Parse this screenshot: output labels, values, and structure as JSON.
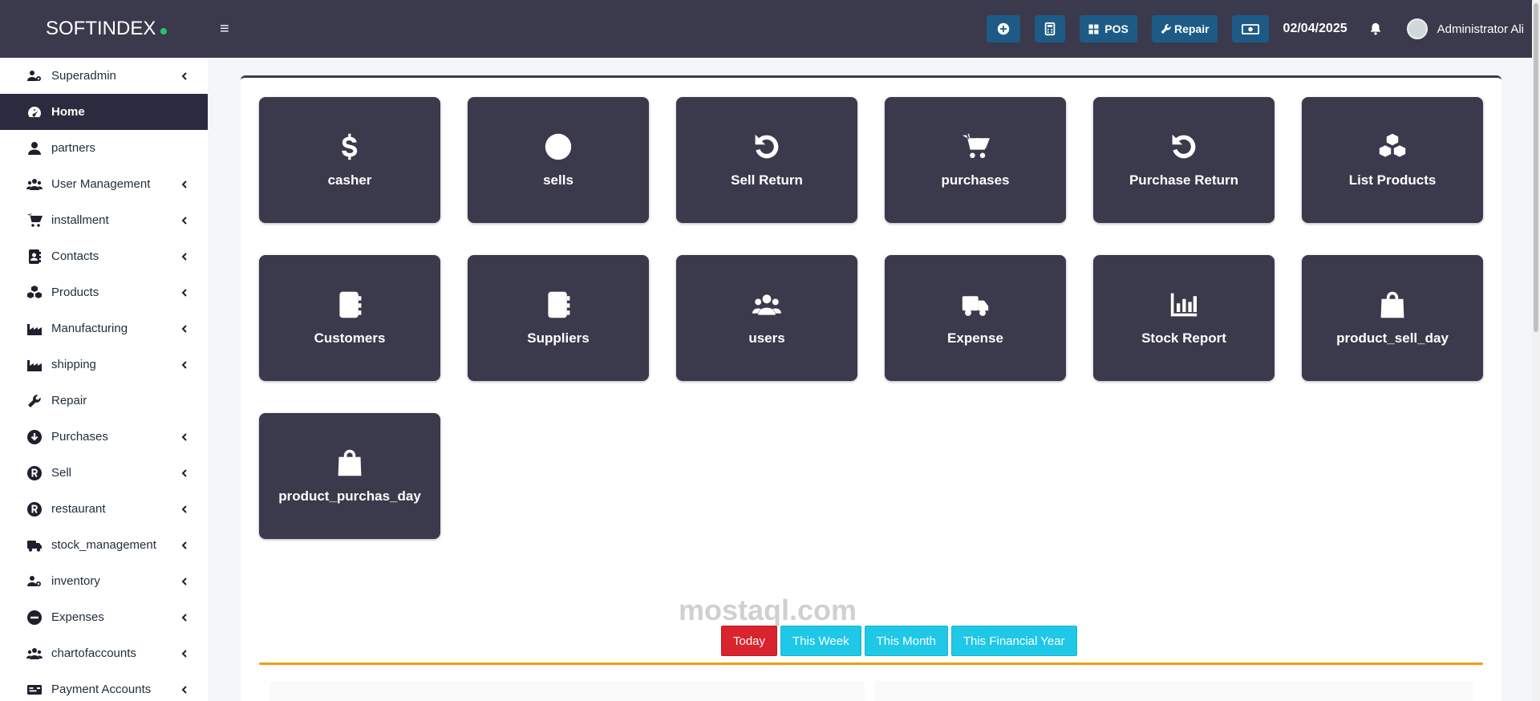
{
  "header": {
    "brand": "SOFTINDEX",
    "menu_icon": "hamburger-icon",
    "actions": [
      {
        "name": "add-button",
        "icon": "plus-circle-icon",
        "label": ""
      },
      {
        "name": "calculator-button",
        "icon": "calculator-icon",
        "label": ""
      },
      {
        "name": "pos-button",
        "icon": "grid-icon",
        "label": "POS"
      },
      {
        "name": "repair-button",
        "icon": "wrench-icon",
        "label": "Repair"
      },
      {
        "name": "cash-button",
        "icon": "money-icon",
        "label": ""
      }
    ],
    "date": "02/04/2025",
    "user": "Administrator Ali"
  },
  "sidebar": {
    "items": [
      {
        "label": "Superadmin",
        "icon": "users-cog-icon",
        "chevron": true
      },
      {
        "label": "Home",
        "icon": "dashboard-icon",
        "chevron": false,
        "active": true
      },
      {
        "label": "partners",
        "icon": "user-icon",
        "chevron": false
      },
      {
        "label": "User Management",
        "icon": "users-icon",
        "chevron": true
      },
      {
        "label": "installment",
        "icon": "cart-plus-icon",
        "chevron": true
      },
      {
        "label": "Contacts",
        "icon": "address-book-icon",
        "chevron": true
      },
      {
        "label": "Products",
        "icon": "cubes-icon",
        "chevron": true
      },
      {
        "label": "Manufacturing",
        "icon": "industry-icon",
        "chevron": true
      },
      {
        "label": "shipping",
        "icon": "industry-icon",
        "chevron": true
      },
      {
        "label": "Repair",
        "icon": "wrench-icon",
        "chevron": false
      },
      {
        "label": "Purchases",
        "icon": "arrow-circle-down-icon",
        "chevron": true
      },
      {
        "label": "Sell",
        "icon": "registered-icon",
        "chevron": true
      },
      {
        "label": "restaurant",
        "icon": "registered-icon",
        "chevron": true
      },
      {
        "label": "stock_management",
        "icon": "truck-icon",
        "chevron": true
      },
      {
        "label": "inventory",
        "icon": "users-cog-icon",
        "chevron": true
      },
      {
        "label": "Expenses",
        "icon": "minus-circle-icon",
        "chevron": true
      },
      {
        "label": "chartofaccounts",
        "icon": "users-icon",
        "chevron": true
      },
      {
        "label": "Payment Accounts",
        "icon": "money-check-icon",
        "chevron": true
      }
    ]
  },
  "tiles": [
    {
      "label": "casher",
      "icon": "dollar-icon"
    },
    {
      "label": "sells",
      "icon": "registered-icon"
    },
    {
      "label": "Sell Return",
      "icon": "undo-icon"
    },
    {
      "label": "purchases",
      "icon": "cart-plus-icon"
    },
    {
      "label": "Purchase Return",
      "icon": "undo-icon"
    },
    {
      "label": "List Products",
      "icon": "cubes-icon"
    },
    {
      "label": "Customers",
      "icon": "address-book-icon"
    },
    {
      "label": "Suppliers",
      "icon": "address-book-icon"
    },
    {
      "label": "users",
      "icon": "users-icon"
    },
    {
      "label": "Expense",
      "icon": "truck-icon"
    },
    {
      "label": "Stock Report",
      "icon": "chart-bar-icon"
    },
    {
      "label": "product_sell_day",
      "icon": "shopping-bag-icon"
    },
    {
      "label": "product_purchas_day",
      "icon": "shopping-bag-icon"
    }
  ],
  "filters": [
    {
      "label": "Today",
      "active": true
    },
    {
      "label": "This Week",
      "active": false
    },
    {
      "label": "This Month",
      "active": false
    },
    {
      "label": "This Financial Year",
      "active": false
    }
  ],
  "watermark": "mostaql.com",
  "colors": {
    "header_bg": "#3b3a4c",
    "tile_bg": "#3b3a4c",
    "accent_button": "#1d5b86",
    "filter_active": "#d9232d",
    "filter_default": "#1ec8e6",
    "panel_border": "#f39c12"
  }
}
